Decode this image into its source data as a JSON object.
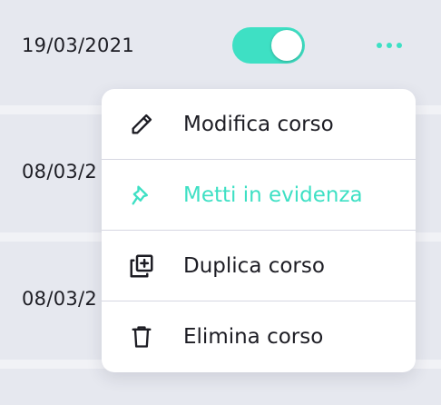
{
  "rows": [
    {
      "date": "19/03/2021",
      "active": true
    },
    {
      "date": "08/03/2"
    },
    {
      "date": "08/03/2"
    }
  ],
  "colors": {
    "accent": "#3ee0c4",
    "text": "#1d1d24",
    "background": "#e6e8ef"
  },
  "menu": {
    "items": [
      {
        "label": "Modifica corso",
        "icon": "pencil-icon"
      },
      {
        "label": "Metti in evidenza",
        "icon": "pin-icon",
        "highlighted": true
      },
      {
        "label": "Duplica corso",
        "icon": "duplicate-icon"
      },
      {
        "label": "Elimina corso",
        "icon": "trash-icon"
      }
    ]
  }
}
